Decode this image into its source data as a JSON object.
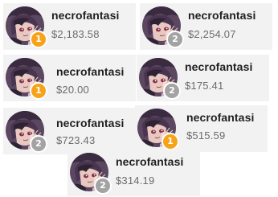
{
  "colors": {
    "rank_1": "#f7a21b",
    "rank_2": "#a3a3a3",
    "card_background": "#f2f2f2",
    "name_text": "#1f1f1f",
    "amount_text": "#6b6b6b"
  },
  "entries": [
    {
      "name": "necrofantasi",
      "amount": "$2,183.58",
      "rank": "1",
      "avatar_icon": "anime-character-avatar"
    },
    {
      "name": "necrofantasi",
      "amount": "$2,254.07",
      "rank": "2",
      "avatar_icon": "anime-character-avatar"
    },
    {
      "name": "necrofantasi",
      "amount": "$20.00",
      "rank": "1",
      "avatar_icon": "anime-character-avatar"
    },
    {
      "name": "necrofantasi",
      "amount": "$175.41",
      "rank": "2",
      "avatar_icon": "anime-character-avatar"
    },
    {
      "name": "necrofantasi",
      "amount": "$723.43",
      "rank": "2",
      "avatar_icon": "anime-character-avatar"
    },
    {
      "name": "necrofantasi",
      "amount": "$515.59",
      "rank": "1",
      "avatar_icon": "anime-character-avatar"
    },
    {
      "name": "necrofantasi",
      "amount": "$314.19",
      "rank": "2",
      "avatar_icon": "anime-character-avatar"
    }
  ]
}
